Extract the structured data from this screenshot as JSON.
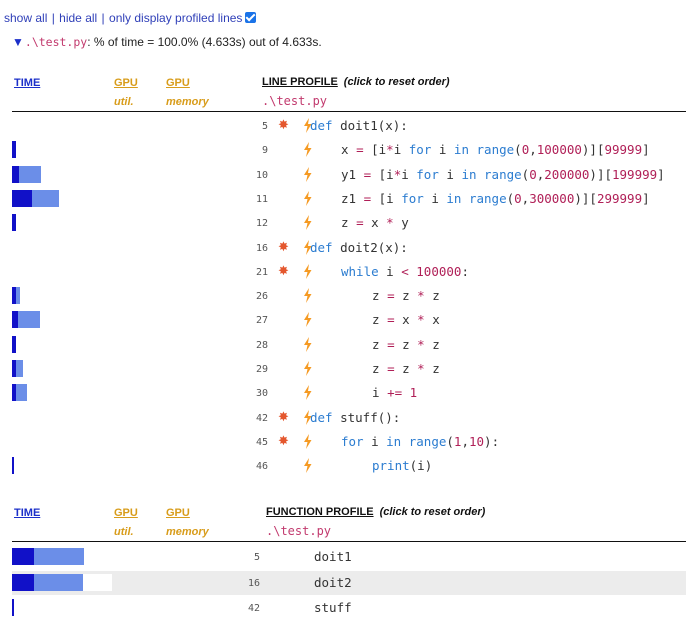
{
  "topbar": {
    "show_all": "show all",
    "hide_all": "hide all",
    "only_profiled": "only display profiled lines",
    "only_profiled_checked": true
  },
  "file_summary": {
    "file": ".\\test.py",
    "text": ": % of time = 100.0% (4.633s) out of 4.633s."
  },
  "line_profile": {
    "time_header": "TIME",
    "gpu_util_header": "GPU",
    "gpu_util_sub": "util.",
    "gpu_mem_header": "GPU",
    "gpu_mem_sub": "memory",
    "title": "LINE PROFILE",
    "reset_hint": "(click to reset order)",
    "file": ".\\test.py",
    "rows": [
      {
        "line": "5",
        "time_dark": 0,
        "time_light": 0,
        "hot": true,
        "code": "def doit1(x):"
      },
      {
        "line": "9",
        "time_dark": 0.04,
        "time_light": 0,
        "hot": false,
        "code": "x = [i*i for i in range(0,100000)][99999]"
      },
      {
        "line": "10",
        "time_dark": 0.07,
        "time_light": 0.22,
        "hot": false,
        "code": "y1 = [i*i for i in range(0,200000)][199999]"
      },
      {
        "line": "11",
        "time_dark": 0.2,
        "time_light": 0.27,
        "hot": false,
        "code": "z1 = [i for i in range(0,300000)][299999]"
      },
      {
        "line": "12",
        "time_dark": 0.04,
        "time_light": 0,
        "hot": false,
        "code": "z = x * y"
      },
      {
        "line": "16",
        "time_dark": 0,
        "time_light": 0,
        "hot": true,
        "code": "def doit2(x):"
      },
      {
        "line": "21",
        "time_dark": 0,
        "time_light": 0,
        "hot": true,
        "code": "while i < 100000:"
      },
      {
        "line": "26",
        "time_dark": 0.04,
        "time_light": 0.04,
        "hot": false,
        "code": "z = z * z"
      },
      {
        "line": "27",
        "time_dark": 0.06,
        "time_light": 0.22,
        "hot": false,
        "code": "z = x * x"
      },
      {
        "line": "28",
        "time_dark": 0.04,
        "time_light": 0,
        "hot": false,
        "code": "z = z * z"
      },
      {
        "line": "29",
        "time_dark": 0.04,
        "time_light": 0.07,
        "hot": false,
        "code": "z = z * z"
      },
      {
        "line": "30",
        "time_dark": 0.04,
        "time_light": 0.11,
        "hot": false,
        "code": "i += 1"
      },
      {
        "line": "42",
        "time_dark": 0,
        "time_light": 0,
        "hot": true,
        "code": "def stuff():"
      },
      {
        "line": "45",
        "time_dark": 0,
        "time_light": 0,
        "hot": true,
        "code": "for i in range(1,10):"
      },
      {
        "line": "46",
        "time_dark": 0.02,
        "time_light": 0,
        "hot": false,
        "code": "print(i)"
      }
    ]
  },
  "function_profile": {
    "time_header": "TIME",
    "gpu_util_header": "GPU",
    "gpu_util_sub": "util.",
    "gpu_mem_header": "GPU",
    "gpu_mem_sub": "memory",
    "title": "FUNCTION PROFILE",
    "reset_hint": "(click to reset order)",
    "file": ".\\test.py",
    "rows": [
      {
        "line": "5",
        "name": "doit1",
        "time_dark": 0.22,
        "time_light": 0.5
      },
      {
        "line": "16",
        "name": "doit2",
        "time_dark": 0.22,
        "time_light": 0.49
      },
      {
        "line": "42",
        "name": "stuff",
        "time_dark": 0.02,
        "time_light": 0
      }
    ]
  },
  "colors": {
    "link": "#2f3fb8",
    "time_dark": "#1111c8",
    "time_light": "#6b8ee8",
    "gpu_header": "#d89c1a",
    "filename": "#c23a6e",
    "keyword": "#2b7cd0",
    "number": "#b01f57",
    "hot_icon": "#e4572e",
    "bolt": "#f59a23"
  },
  "icons": {
    "expand": "triangle-down-icon",
    "hot": "explosion-icon",
    "bolt": "lightning-bolt-icon",
    "checkbox": "checkbox-checked-icon"
  }
}
